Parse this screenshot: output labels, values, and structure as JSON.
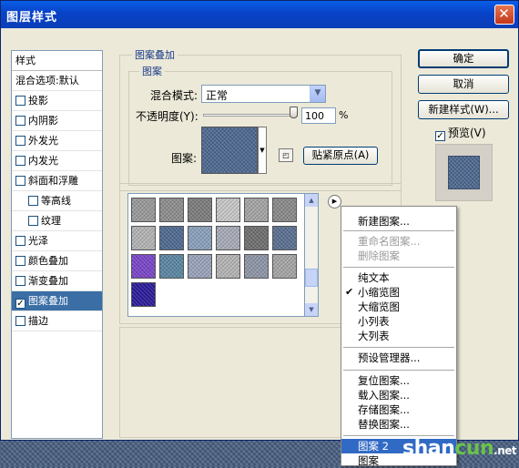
{
  "window": {
    "title": "图层样式",
    "close_glyph": "✕"
  },
  "sidebar": {
    "header": "样式",
    "blend_options": "混合选项:默认",
    "items": [
      {
        "label": "投影",
        "checked": false,
        "sub": false
      },
      {
        "label": "内阴影",
        "checked": false,
        "sub": false
      },
      {
        "label": "外发光",
        "checked": false,
        "sub": false
      },
      {
        "label": "内发光",
        "checked": false,
        "sub": false
      },
      {
        "label": "斜面和浮雕",
        "checked": false,
        "sub": false
      },
      {
        "label": "等高线",
        "checked": false,
        "sub": true
      },
      {
        "label": "纹理",
        "checked": false,
        "sub": true
      },
      {
        "label": "光泽",
        "checked": false,
        "sub": false
      },
      {
        "label": "颜色叠加",
        "checked": false,
        "sub": false
      },
      {
        "label": "渐变叠加",
        "checked": false,
        "sub": false
      },
      {
        "label": "图案叠加",
        "checked": true,
        "sub": false,
        "active": true
      },
      {
        "label": "描边",
        "checked": false,
        "sub": false
      }
    ]
  },
  "panel": {
    "outer_title": "图案叠加",
    "inner_title": "图案",
    "blend_mode_label": "混合模式:",
    "blend_mode_value": "正常",
    "opacity_label": "不透明度(Y):",
    "opacity_value": "100",
    "opacity_unit": "%",
    "opacity_level": 1.0,
    "pattern_label": "图案:",
    "snap_button": "贴紧原点(A)",
    "flyout_glyph": "▶"
  },
  "buttons": {
    "ok": "确定",
    "cancel": "取消",
    "new_style": "新建样式(W)...",
    "preview_label": "预览(V)",
    "preview_checked": true
  },
  "swatches": {
    "colors": [
      "#9a9a9a",
      "#8e8e8e",
      "#7d7d7d",
      "#c8c8c8",
      "#a5a5a5",
      "#8a8a8a",
      "#b4b4b4",
      "#4f6a92",
      "#8aa1bd",
      "#a8acb8",
      "#6f6f6f",
      "#5a6f92",
      "#7a45c9",
      "#5a86a4",
      "#9aa3bc",
      "#b5b5b5",
      "#8e96a8",
      "#a6a6a6",
      "#2a1a9a"
    ]
  },
  "menu": {
    "items": [
      {
        "label": "新建图案...",
        "disabled": false,
        "checked": false
      },
      {
        "label": "重命名图案...",
        "disabled": true,
        "checked": false
      },
      {
        "label": "删除图案",
        "disabled": true,
        "checked": false
      },
      {
        "label": "纯文本",
        "disabled": false,
        "checked": false
      },
      {
        "label": "小缩览图",
        "disabled": false,
        "checked": true
      },
      {
        "label": "大缩览图",
        "disabled": false,
        "checked": false
      },
      {
        "label": "小列表",
        "disabled": false,
        "checked": false
      },
      {
        "label": "大列表",
        "disabled": false,
        "checked": false
      },
      {
        "label": "预设管理器...",
        "disabled": false,
        "checked": false
      },
      {
        "label": "复位图案...",
        "disabled": false,
        "checked": false
      },
      {
        "label": "载入图案...",
        "disabled": false,
        "checked": false
      },
      {
        "label": "存储图案...",
        "disabled": false,
        "checked": false
      },
      {
        "label": "替换图案...",
        "disabled": false,
        "checked": false
      },
      {
        "label": "图案 2",
        "disabled": false,
        "checked": false,
        "highlighted": true
      },
      {
        "label": "图案",
        "disabled": false,
        "checked": false
      }
    ]
  },
  "watermark": {
    "text_a": "shan",
    "text_b": "cun",
    "text_c": ".net"
  },
  "colors": {
    "accent": "#316ac5",
    "title_blue": "#0842c6",
    "selected_row": "#3a6ea5",
    "denim": "#4f6a92"
  }
}
